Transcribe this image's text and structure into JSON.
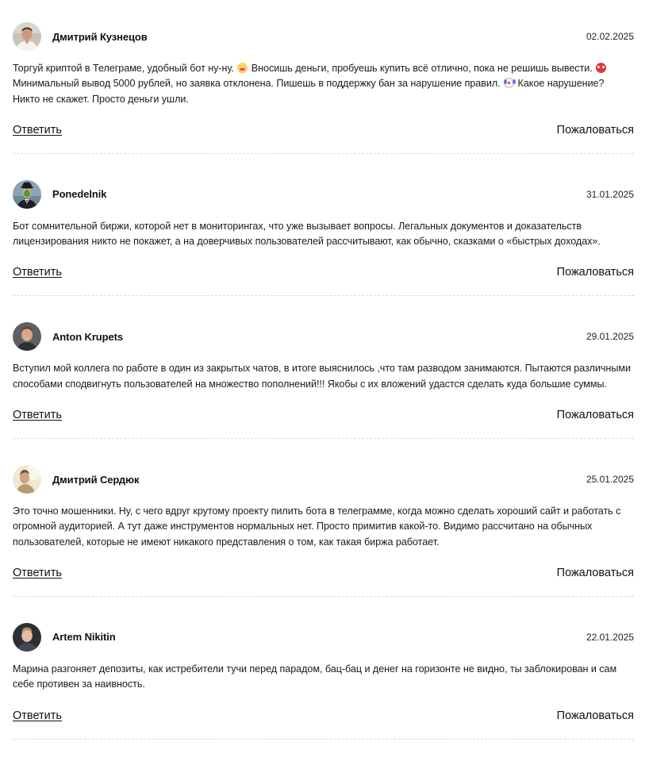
{
  "comments": [
    {
      "author": "Дмитрий Кузнецов",
      "avatar": "photo-man-white-shirt",
      "date": "02.02.2025",
      "text_parts": [
        "Торгуй криптой в Телеграме, удобный бот ну-ну. ",
        " Вносишь деньги, пробуешь купить всё отлично, пока не решишь вывести. ",
        " Минимальный вывод 5000 рублей, но заявка отклонена. Пишешь в поддержку бан за нарушение правил. ",
        " Какое нарушение? Никто не скажет. Просто деньги ушли."
      ],
      "emojis": [
        "laughing-emoji",
        "angry-face-emoji",
        "clown-face-emoji"
      ],
      "reply": "Ответить",
      "complain": "Пожаловаться"
    },
    {
      "author": "Ponedelnik",
      "avatar": "illustration-man-bowler-hat-green-apple",
      "date": "31.01.2025",
      "text": "Бот сомнительной биржи, которой нет в мониторингах, что уже вызывает вопросы. Легальных документов и доказательств лицензирования никто не покажет, а на доверчивых пользователей рассчитывают, как обычно, сказками о «быстрых доходах».",
      "reply": "Ответить",
      "complain": "Пожаловаться"
    },
    {
      "author": "Anton Krupets",
      "avatar": "photo-smiling-man",
      "date": "29.01.2025",
      "text": "Вступил мой коллега по работе в один из закрытых чатов, в итоге выяснилось ,что там разводом занимаются. Пытаются различными способами сподвигнуть пользователей на множество пополнений!!! Якобы с их вложений удастся сделать куда большие суммы.",
      "reply": "Ответить",
      "complain": "Пожаловаться"
    },
    {
      "author": "Дмитрий Сердюк",
      "avatar": "photo-man-bright-background",
      "date": "25.01.2025",
      "text": "Это точно мошенники. Ну, с чего вдруг крутому проекту пилить бота в телеграмме, когда можно сделать хороший сайт и работать с огромной аудиторией. А тут даже инструментов нормальных нет. Просто примитив какой-то. Видимо рассчитано на обычных пользователей, которые не имеют никакого представления о том, как такая биржа работает.",
      "reply": "Ответить",
      "complain": "Пожаловаться"
    },
    {
      "author": "Artem Nikitin",
      "avatar": "photo-man-dark-background",
      "date": "22.01.2025",
      "text": "Марина разгоняет депозиты, как истребители тучи перед парадом, бац-бац и денег на горизонте не видно, ты заблокирован и сам себе противен за наивность.",
      "reply": "Ответить",
      "complain": "Пожаловаться"
    }
  ]
}
